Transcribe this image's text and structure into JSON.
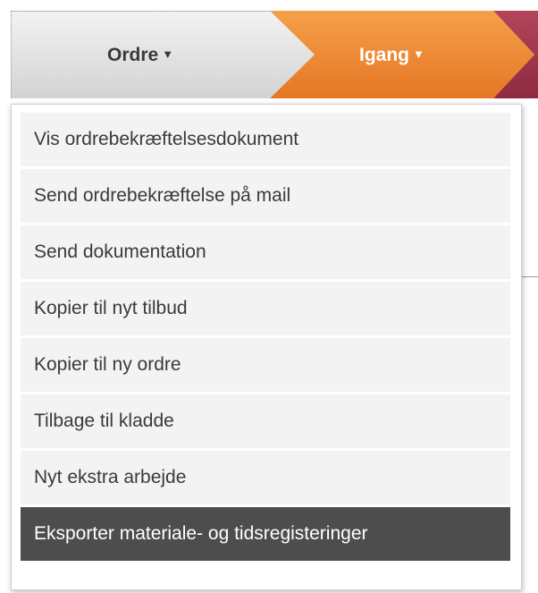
{
  "breadcrumb": {
    "ordre_label": "Ordre",
    "igang_label": "Igang",
    "dropdown_arrow": "▼"
  },
  "menu": {
    "items": [
      {
        "label": "Vis ordrebekræftelsesdokument"
      },
      {
        "label": "Send ordrebekræftelse på mail"
      },
      {
        "label": "Send dokumentation"
      },
      {
        "label": "Kopier til nyt tilbud"
      },
      {
        "label": "Kopier til ny ordre"
      },
      {
        "label": "Tilbage til kladde"
      },
      {
        "label": "Nyt ekstra arbejde"
      },
      {
        "label": "Eksporter materiale- og tidsregisteringer",
        "highlighted": true
      }
    ]
  },
  "colors": {
    "ordre_bg": "#d9d9d9",
    "igang_bg": "#ee8a34",
    "next_stage_bg": "#a13852",
    "menu_item_bg": "#f3f3f3",
    "menu_item_highlight_bg": "#4d4d4d"
  }
}
